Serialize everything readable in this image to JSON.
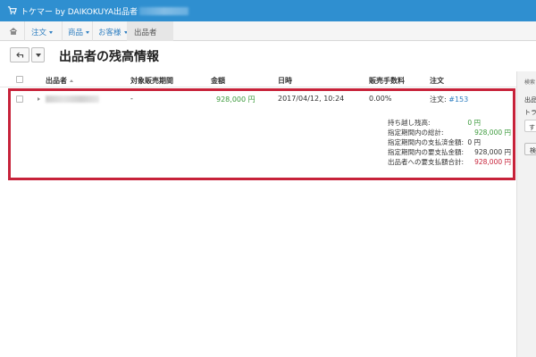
{
  "topbar": {
    "brand": "トケマー by DAIKOKUYA",
    "seller_label": "出品者"
  },
  "nav": {
    "items": [
      {
        "label": "注文"
      },
      {
        "label": "商品"
      },
      {
        "label": "お客様"
      }
    ],
    "active_item": "出品者"
  },
  "page": {
    "title": "出品者の残高情報"
  },
  "table": {
    "headers": {
      "seller": "出品者",
      "sales_period": "対象販売期間",
      "amount": "金額",
      "datetime": "日時",
      "commission": "販売手数料",
      "order": "注文"
    },
    "row": {
      "sales_period": "-",
      "amount": "928,000 円",
      "datetime": "2017/04/12, 10:24",
      "commission": "0.00%",
      "order_prefix": "注文:",
      "order_link": "#153"
    }
  },
  "summary": [
    {
      "label": "持ち越し残高:",
      "value": "0 円",
      "color": "#3c9a3c"
    },
    {
      "label": "指定期間内の総計:",
      "value": "928,000 円",
      "color": "#3c9a3c"
    },
    {
      "label": "指定期間内の支払済金額:",
      "value": "0 円",
      "color": "#333333"
    },
    {
      "label": "指定期間内の要支払金額:",
      "value": "928,000 円",
      "color": "#333333"
    },
    {
      "label": "出品者への要支払額合計:",
      "value": "928,000 円",
      "color": "#c7223a"
    }
  ],
  "sidepanel": {
    "heading": "検索",
    "label1": "出品",
    "label2": "トラ",
    "select_value": "す",
    "button_label": "検"
  },
  "colors": {
    "topbar": "#2f8fd0",
    "accent_link": "#2f7fc1",
    "highlight": "#c7223a",
    "positive": "#3c9a3c"
  }
}
